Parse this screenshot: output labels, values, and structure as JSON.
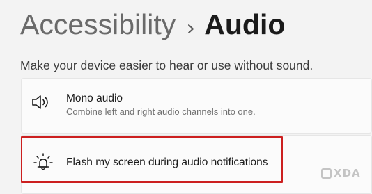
{
  "header": {
    "breadcrumb_parent": "Accessibility",
    "breadcrumb_separator": "chevron-right-icon",
    "page_title": "Audio"
  },
  "description": "Make your device easier to hear or use without sound.",
  "settings": [
    {
      "icon": "speaker-icon",
      "title": "Mono audio",
      "subtitle": "Combine left and right audio channels into one."
    },
    {
      "icon": "flash-notification-icon",
      "title": "Flash my screen during audio notifications",
      "highlighted": true
    }
  ],
  "colors": {
    "highlight_border": "#cc1f1f",
    "background": "#f3f3f3",
    "card": "#fbfbfb"
  },
  "watermark": {
    "text": "XDA"
  }
}
